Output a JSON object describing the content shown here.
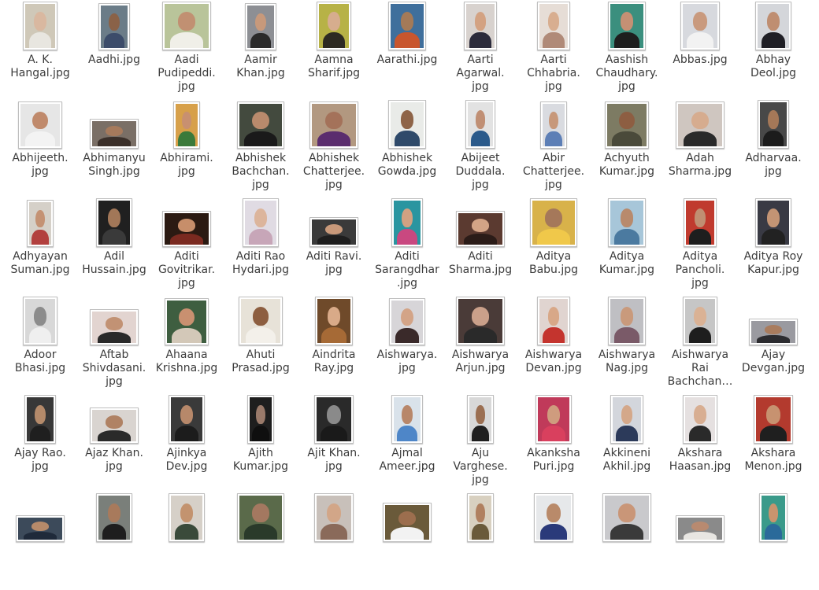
{
  "files": [
    {
      "name": "A. K. Hangal.jpg",
      "lines": [
        "A. K.",
        "Hangal.jpg"
      ],
      "w": 44,
      "h": 62,
      "bg": "#cfc8b8",
      "skin": "#d9b8a0",
      "shirt": "#e8e6e0"
    },
    {
      "name": "Aadhi.jpg",
      "lines": [
        "Aadhi.jpg"
      ],
      "w": 40,
      "h": 60,
      "bg": "#6b7c88",
      "skin": "#8a6248",
      "shirt": "#3c4c6a"
    },
    {
      "name": "Aadi Pudipeddi.jpg",
      "lines": [
        "Aadi",
        "Pudipeddi.",
        "jpg"
      ],
      "w": 62,
      "h": 62,
      "bg": "#b9c49a",
      "skin": "#c19072",
      "shirt": "#f0efe8"
    },
    {
      "name": "Aamir Khan.jpg",
      "lines": [
        "Aamir",
        "Khan.jpg"
      ],
      "w": 40,
      "h": 60,
      "bg": "#8d8f94",
      "skin": "#c7997b",
      "shirt": "#2a2a2a"
    },
    {
      "name": "Aamna Sharif.jpg",
      "lines": [
        "Aamna",
        "Sharif.jpg"
      ],
      "w": 44,
      "h": 62,
      "bg": "#b7b246",
      "skin": "#d6ad8e",
      "shirt": "#2d2a22"
    },
    {
      "name": "Aarathi.jpg",
      "lines": [
        "Aarathi.jpg"
      ],
      "w": 48,
      "h": 62,
      "bg": "#3f6f9c",
      "skin": "#a47a58",
      "shirt": "#c8562e"
    },
    {
      "name": "Aarti Agarwal.jpg",
      "lines": [
        "Aarti",
        "Agarwal.",
        "jpg"
      ],
      "w": 42,
      "h": 62,
      "bg": "#d8d2ce",
      "skin": "#d3a282",
      "shirt": "#2b2b3b"
    },
    {
      "name": "Aarti Chhabria.jpg",
      "lines": [
        "Aarti",
        "Chhabria.",
        "jpg"
      ],
      "w": 42,
      "h": 62,
      "bg": "#e6ddd6",
      "skin": "#d8ae90",
      "shirt": "#b08a78"
    },
    {
      "name": "Aashish Chaudhary.jpg",
      "lines": [
        "Aashish",
        "Chaudhary.",
        "jpg"
      ],
      "w": 48,
      "h": 62,
      "bg": "#3b8f7e",
      "skin": "#c59074",
      "shirt": "#1e1e1e"
    },
    {
      "name": "Abbas.jpg",
      "lines": [
        "Abbas.jpg"
      ],
      "w": 50,
      "h": 62,
      "bg": "#d7d9de",
      "skin": "#c99a7e",
      "shirt": "#f2f2f2"
    },
    {
      "name": "Abhay Deol.jpg",
      "lines": [
        "Abhay",
        "Deol.jpg"
      ],
      "w": 46,
      "h": 62,
      "bg": "#d4d6da",
      "skin": "#bf8e71",
      "shirt": "#1f1f25"
    },
    {
      "name": "Abhijeeth.jpg",
      "lines": [
        "Abhijeeth.",
        "jpg"
      ],
      "w": 56,
      "h": 60,
      "bg": "#e6e6e6",
      "skin": "#c08a6c",
      "shirt": "#f3f3f3"
    },
    {
      "name": "Abhimanyu Singh.jpg",
      "lines": [
        "Abhimanyu",
        "Singh.jpg"
      ],
      "w": 62,
      "h": 38,
      "bg": "#7a6f66",
      "skin": "#a67a5c",
      "shirt": "#3b302a"
    },
    {
      "name": "Abhirami.jpg",
      "lines": [
        "Abhirami.",
        "jpg"
      ],
      "w": 34,
      "h": 60,
      "bg": "#d7a04a",
      "skin": "#c89070",
      "shirt": "#3b7a3a"
    },
    {
      "name": "Abhishek Bachchan.jpg",
      "lines": [
        "Abhishek",
        "Bachchan.",
        "jpg"
      ],
      "w": 60,
      "h": 60,
      "bg": "#434a3e",
      "skin": "#b98a6c",
      "shirt": "#1a1a1a"
    },
    {
      "name": "Abhishek Chatterjee.jpg",
      "lines": [
        "Abhishek",
        "Chatterjee.",
        "jpg"
      ],
      "w": 62,
      "h": 60,
      "bg": "#b29880",
      "skin": "#a4725a",
      "shirt": "#5b2d6e"
    },
    {
      "name": "Abhishek Gowda.jpg",
      "lines": [
        "Abhishek",
        "Gowda.jpg"
      ],
      "w": 48,
      "h": 62,
      "bg": "#e9ebe8",
      "skin": "#8e6448",
      "shirt": "#2f4a6a"
    },
    {
      "name": "Abijeet Duddala.jpg",
      "lines": [
        "Abijeet",
        "Duddala.",
        "jpg"
      ],
      "w": 38,
      "h": 62,
      "bg": "#e2e2e2",
      "skin": "#c08f74",
      "shirt": "#2b5a8b"
    },
    {
      "name": "Abir Chatterjee.jpg",
      "lines": [
        "Abir",
        "Chatterjee.",
        "jpg"
      ],
      "w": 34,
      "h": 60,
      "bg": "#d9dbe0",
      "skin": "#c7987a",
      "shirt": "#5d7fb6"
    },
    {
      "name": "Achyuth Kumar.jpg",
      "lines": [
        "Achyuth",
        "Kumar.jpg"
      ],
      "w": 56,
      "h": 60,
      "bg": "#7d7b63",
      "skin": "#8d5e42",
      "shirt": "#4a4a3a"
    },
    {
      "name": "Adah Sharma.jpg",
      "lines": [
        "Adah",
        "Sharma.jpg"
      ],
      "w": 62,
      "h": 60,
      "bg": "#cfc6c0",
      "skin": "#d6ac8f",
      "shirt": "#2a2a2a"
    },
    {
      "name": "Adharvaa.jpg",
      "lines": [
        "Adharvaa.",
        "jpg"
      ],
      "w": 40,
      "h": 62,
      "bg": "#484848",
      "skin": "#a57858",
      "shirt": "#1c1c1c"
    },
    {
      "name": "Adhyayan Suman.jpg",
      "lines": [
        "Adhyayan",
        "Suman.jpg"
      ],
      "w": 34,
      "h": 60,
      "bg": "#d5d0c8",
      "skin": "#c49274",
      "shirt": "#b2403e"
    },
    {
      "name": "Adil Hussain.jpg",
      "lines": [
        "Adil",
        "Hussain.jpg"
      ],
      "w": 46,
      "h": 62,
      "bg": "#202020",
      "skin": "#a27758",
      "shirt": "#3a3a3a"
    },
    {
      "name": "Aditi Govitrikar.jpg",
      "lines": [
        "Aditi",
        "Govitrikar.",
        "jpg"
      ],
      "w": 62,
      "h": 46,
      "bg": "#2b1a12",
      "skin": "#c78e6a",
      "shirt": "#7a2a20"
    },
    {
      "name": "Aditi Rao Hydari.jpg",
      "lines": [
        "Aditi Rao",
        "Hydari.jpg"
      ],
      "w": 46,
      "h": 62,
      "bg": "#e0dbe3",
      "skin": "#dcb59c",
      "shirt": "#c7a6b8"
    },
    {
      "name": "Aditi Ravi.jpg",
      "lines": [
        "Aditi Ravi.",
        "jpg"
      ],
      "w": 62,
      "h": 38,
      "bg": "#3a3a3a",
      "skin": "#c9997a",
      "shirt": "#1e1e1e"
    },
    {
      "name": "Aditi Sarangdhar.jpg",
      "lines": [
        "Aditi",
        "Sarangdhar",
        ".jpg"
      ],
      "w": 40,
      "h": 62,
      "bg": "#2a95a0",
      "skin": "#d1a182",
      "shirt": "#c94880"
    },
    {
      "name": "Aditi Sharma.jpg",
      "lines": [
        "Aditi",
        "Sharma.jpg"
      ],
      "w": 62,
      "h": 46,
      "bg": "#5b3a30",
      "skin": "#d3a486",
      "shirt": "#2b1c18"
    },
    {
      "name": "Aditya Babu.jpg",
      "lines": [
        "Aditya",
        "Babu.jpg"
      ],
      "w": 60,
      "h": 62,
      "bg": "#d8b24a",
      "skin": "#a5785a",
      "shirt": "#f0c84a"
    },
    {
      "name": "Aditya Kumar.jpg",
      "lines": [
        "Aditya",
        "Kumar.jpg"
      ],
      "w": 48,
      "h": 62,
      "bg": "#a7c6d9",
      "skin": "#b88a6c",
      "shirt": "#4b7aa0"
    },
    {
      "name": "Aditya Pancholi.jpg",
      "lines": [
        "Aditya",
        "Pancholi.",
        "jpg"
      ],
      "w": 42,
      "h": 62,
      "bg": "#c03a2e",
      "skin": "#c08e72",
      "shirt": "#1e1e1e"
    },
    {
      "name": "Aditya Roy Kapur.jpg",
      "lines": [
        "Aditya Roy",
        "Kapur.jpg"
      ],
      "w": 46,
      "h": 62,
      "bg": "#393a44",
      "skin": "#c39474",
      "shirt": "#222"
    },
    {
      "name": "Adoor Bhasi.jpg",
      "lines": [
        "Adoor",
        "Bhasi.jpg"
      ],
      "w": 44,
      "h": 62,
      "bg": "#d8d8d8",
      "skin": "#8c8c8c",
      "shirt": "#efefef"
    },
    {
      "name": "Aftab Shivdasani.jpg",
      "lines": [
        "Aftab",
        "Shivdasani.",
        "jpg"
      ],
      "w": 62,
      "h": 46,
      "bg": "#e2d4d0",
      "skin": "#c29274",
      "shirt": "#2a2a2a"
    },
    {
      "name": "Ahaana Krishna.jpg",
      "lines": [
        "Ahaana",
        "Krishna.jpg"
      ],
      "w": 56,
      "h": 60,
      "bg": "#3e5e40",
      "skin": "#c99070",
      "shirt": "#d3c8b8"
    },
    {
      "name": "Ahuti Prasad.jpg",
      "lines": [
        "Ahuti",
        "Prasad.jpg"
      ],
      "w": 56,
      "h": 62,
      "bg": "#e7e2d8",
      "skin": "#8d5e40",
      "shirt": "#f3f0ea"
    },
    {
      "name": "Aindrita Ray.jpg",
      "lines": [
        "Aindrita",
        "Ray.jpg"
      ],
      "w": 48,
      "h": 62,
      "bg": "#6f4a2a",
      "skin": "#d9aa88",
      "shirt": "#a66a36"
    },
    {
      "name": "Aishwarya.jpg",
      "lines": [
        "Aishwarya.",
        "jpg"
      ],
      "w": 46,
      "h": 60,
      "bg": "#d7d5d8",
      "skin": "#d3a487",
      "shirt": "#3a2a2a"
    },
    {
      "name": "Aishwarya Arjun.jpg",
      "lines": [
        "Aishwarya",
        "Arjun.jpg"
      ],
      "w": 62,
      "h": 62,
      "bg": "#4a3b38",
      "skin": "#caa08a",
      "shirt": "#2a2a2a"
    },
    {
      "name": "Aishwarya Devan.jpg",
      "lines": [
        "Aishwarya",
        "Devan.jpg"
      ],
      "w": 42,
      "h": 62,
      "bg": "#e0d4d0",
      "skin": "#d8a888",
      "shirt": "#c4342e"
    },
    {
      "name": "Aishwarya Nag.jpg",
      "lines": [
        "Aishwarya",
        "Nag.jpg"
      ],
      "w": 48,
      "h": 62,
      "bg": "#bfbfc3",
      "skin": "#c99a7c",
      "shirt": "#7a5a68"
    },
    {
      "name": "Aishwarya Rai Bachchan.jpg",
      "lines": [
        "Aishwarya",
        "Rai",
        "Bachchan…"
      ],
      "w": 44,
      "h": 62,
      "bg": "#c6c6c6",
      "skin": "#dab295",
      "shirt": "#1e1e1e"
    },
    {
      "name": "Ajay Devgan.jpg",
      "lines": [
        "Ajay",
        "Devgan.jpg"
      ],
      "w": 62,
      "h": 34,
      "bg": "#9a9aa0",
      "skin": "#a97c5e",
      "shirt": "#2c2c30"
    },
    {
      "name": "Ajay Rao.jpg",
      "lines": [
        "Ajay Rao.",
        "jpg"
      ],
      "w": 40,
      "h": 62,
      "bg": "#383838",
      "skin": "#b48a6a",
      "shirt": "#1f1f1f"
    },
    {
      "name": "Ajaz Khan.jpg",
      "lines": [
        "Ajaz Khan.",
        "jpg"
      ],
      "w": 62,
      "h": 46,
      "bg": "#d9d4d0",
      "skin": "#b08264",
      "shirt": "#2a2a2a"
    },
    {
      "name": "Ajinkya Dev.jpg",
      "lines": [
        "Ajinkya",
        "Dev.jpg"
      ],
      "w": 46,
      "h": 62,
      "bg": "#3a3a3a",
      "skin": "#b7886a",
      "shirt": "#1c1c1c"
    },
    {
      "name": "Ajith Kumar.jpg",
      "lines": [
        "Ajith",
        "Kumar.jpg"
      ],
      "w": 34,
      "h": 62,
      "bg": "#1e1e1e",
      "skin": "#9a7a6a",
      "shirt": "#0f0f0f"
    },
    {
      "name": "Ajit Khan.jpg",
      "lines": [
        "Ajit Khan.",
        "jpg"
      ],
      "w": 50,
      "h": 62,
      "bg": "#2a2a2a",
      "skin": "#8a8a8a",
      "shirt": "#1a1a1a"
    },
    {
      "name": "Ajmal Ameer.jpg",
      "lines": [
        "Ajmal",
        "Ameer.jpg"
      ],
      "w": 40,
      "h": 62,
      "bg": "#d9e2ea",
      "skin": "#b8876a",
      "shirt": "#4e86c8"
    },
    {
      "name": "Aju Varghese.jpg",
      "lines": [
        "Aju",
        "Varghese.",
        "jpg"
      ],
      "w": 34,
      "h": 62,
      "bg": "#d8d8d8",
      "skin": "#9b6f52",
      "shirt": "#1f1f1f"
    },
    {
      "name": "Akanksha Puri.jpg",
      "lines": [
        "Akanksha",
        "Puri.jpg"
      ],
      "w": 46,
      "h": 62,
      "bg": "#c03a5a",
      "skin": "#cf9c7e",
      "shirt": "#d9405e"
    },
    {
      "name": "Akkineni Akhil.jpg",
      "lines": [
        "Akkineni",
        "Akhil.jpg"
      ],
      "w": 42,
      "h": 62,
      "bg": "#d3d6dc",
      "skin": "#d4a88a",
      "shirt": "#2c3a5a"
    },
    {
      "name": "Akshara Haasan.jpg",
      "lines": [
        "Akshara",
        "Haasan.jpg"
      ],
      "w": 44,
      "h": 62,
      "bg": "#e5e0e0",
      "skin": "#d8ae92",
      "shirt": "#2a2a2a"
    },
    {
      "name": "Akshara Menon.jpg",
      "lines": [
        "Akshara",
        "Menon.jpg"
      ],
      "w": 50,
      "h": 62,
      "bg": "#b33a2e",
      "skin": "#c79270",
      "shirt": "#1f1f1f"
    },
    {
      "name": "row6-01.jpg",
      "lines": [
        ""
      ],
      "w": 62,
      "h": 34,
      "bg": "#3c4a5a",
      "skin": "#b68a6a",
      "shirt": "#1f2a3a"
    },
    {
      "name": "row6-02.jpg",
      "lines": [
        ""
      ],
      "w": 46,
      "h": 62,
      "bg": "#7a7f7a",
      "skin": "#a87a5c",
      "shirt": "#1e1e1e"
    },
    {
      "name": "row6-03.jpg",
      "lines": [
        ""
      ],
      "w": 46,
      "h": 62,
      "bg": "#d6d0c8",
      "skin": "#c3936f",
      "shirt": "#3a4a3a"
    },
    {
      "name": "row6-04.jpg",
      "lines": [
        ""
      ],
      "w": 60,
      "h": 62,
      "bg": "#5a6a4a",
      "skin": "#a47860",
      "shirt": "#2a3a2a"
    },
    {
      "name": "row6-05.jpg",
      "lines": [
        ""
      ],
      "w": 50,
      "h": 62,
      "bg": "#c8c0ba",
      "skin": "#d2a688",
      "shirt": "#8a6a5a"
    },
    {
      "name": "row6-06.jpg",
      "lines": [
        ""
      ],
      "w": 62,
      "h": 50,
      "bg": "#6a5a3a",
      "skin": "#9c6e4e",
      "shirt": "#f2f2f2"
    },
    {
      "name": "row6-07.jpg",
      "lines": [
        ""
      ],
      "w": 34,
      "h": 62,
      "bg": "#d8d0c0",
      "skin": "#b08060",
      "shirt": "#6a5a3a"
    },
    {
      "name": "row6-08.jpg",
      "lines": [
        ""
      ],
      "w": 50,
      "h": 62,
      "bg": "#e6e8ea",
      "skin": "#b98a6a",
      "shirt": "#2a3a7a"
    },
    {
      "name": "row6-09.jpg",
      "lines": [
        ""
      ],
      "w": 62,
      "h": 62,
      "bg": "#c9c9cc",
      "skin": "#c99678",
      "shirt": "#3a3a3a"
    },
    {
      "name": "row6-10.jpg",
      "lines": [
        ""
      ],
      "w": 62,
      "h": 34,
      "bg": "#8a8a8a",
      "skin": "#b88a70",
      "shirt": "#e8e6e2"
    },
    {
      "name": "row6-11.jpg",
      "lines": [
        ""
      ],
      "w": 36,
      "h": 62,
      "bg": "#3a9a8a",
      "skin": "#c8946e",
      "shirt": "#2a6a9a"
    }
  ]
}
